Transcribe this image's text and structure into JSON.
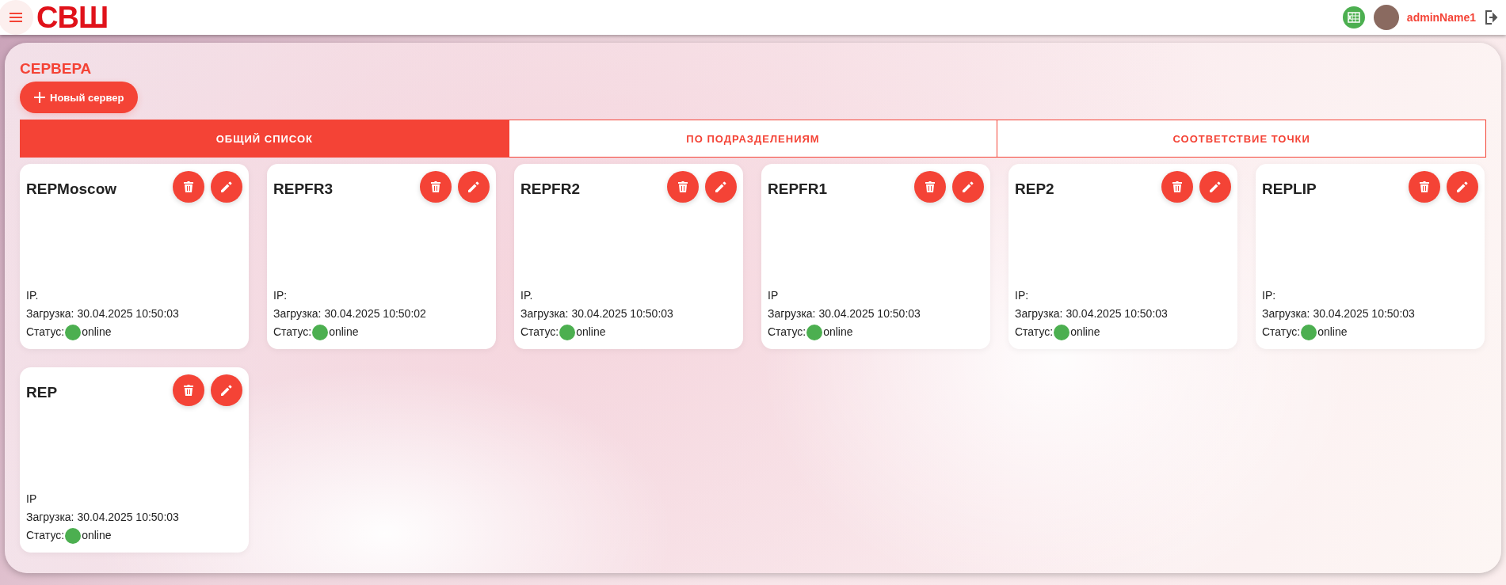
{
  "header": {
    "logo": "СВШ",
    "user": "adminName1"
  },
  "page": {
    "title": "СЕРВЕРА",
    "add_button": "Новый сервер"
  },
  "tabs": [
    {
      "label": "ОБЩИЙ СПИСОК",
      "selected": true
    },
    {
      "label": "ПО ПОДРАЗДЕЛЕНИЯМ",
      "selected": false
    },
    {
      "label": "СООТВЕТСТВИЕ ТОЧКИ",
      "selected": false
    }
  ],
  "servers": [
    {
      "name": "REPMoscow",
      "ip": "IP.",
      "load": "Загрузка: 30.04.2025 10:50:03",
      "status_label": "Статус:",
      "status": "online",
      "color": "#4caf50"
    },
    {
      "name": "REPFR3",
      "ip": "IP:",
      "load": "Загрузка: 30.04.2025 10:50:02",
      "status_label": "Статус:",
      "status": "online",
      "color": "#4caf50"
    },
    {
      "name": "REPFR2",
      "ip": "IP.",
      "load": "Загрузка: 30.04.2025 10:50:03",
      "status_label": "Статус:",
      "status": "online",
      "color": "#4caf50"
    },
    {
      "name": "REPFR1",
      "ip": "IP",
      "load": "Загрузка: 30.04.2025 10:50:03",
      "status_label": "Статус:",
      "status": "online",
      "color": "#4caf50"
    },
    {
      "name": "REP2",
      "ip": "IP:",
      "load": "Загрузка: 30.04.2025 10:50:03",
      "status_label": "Статус:",
      "status": "online",
      "color": "#4caf50"
    },
    {
      "name": "REPLIP",
      "ip": "IP:",
      "load": "Загрузка: 30.04.2025 10:50:03",
      "status_label": "Статус:",
      "status": "online",
      "color": "#4caf50"
    },
    {
      "name": "REP",
      "ip": "IP",
      "load": "Загрузка: 30.04.2025 10:50:03",
      "status_label": "Статус:",
      "status": "online",
      "color": "#4caf50"
    }
  ]
}
